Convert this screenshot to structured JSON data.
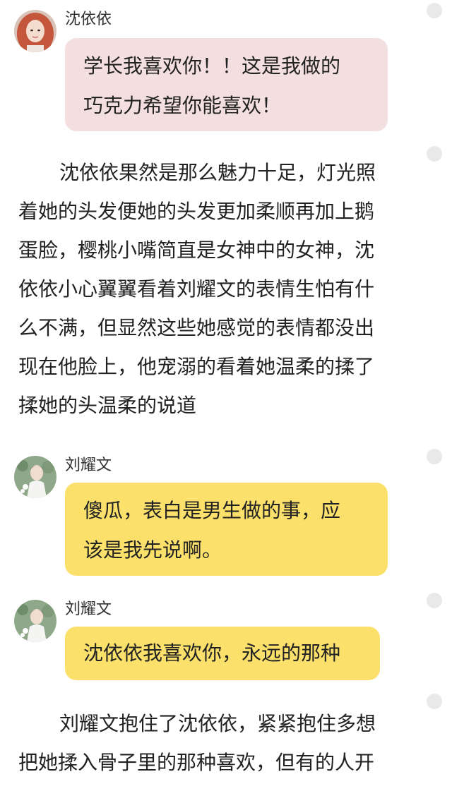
{
  "messages": [
    {
      "speaker": "沈依依",
      "bubble_lines": [
        "学长我喜欢你！！这是我做的",
        "巧克力希望你能喜欢！"
      ],
      "bubble_color": "#f3dfdf",
      "avatar": "female-avatar"
    },
    {
      "speaker": "刘耀文",
      "bubble_lines": [
        "傻瓜，表白是男生做的事，应",
        "该是我先说啊。"
      ],
      "bubble_color": "#fbe16c",
      "avatar": "male-avatar"
    },
    {
      "speaker": "刘耀文",
      "bubble_lines": [
        "沈依依我喜欢你，永远的那种"
      ],
      "bubble_color": "#fbe16c",
      "avatar": "male-avatar"
    }
  ],
  "narrations": [
    {
      "lines": [
        "沈依依果然是那么魅力十足，灯光照",
        "着她的头发便她的头发更加柔顺再加上鹅",
        "蛋脸，樱桃小嘴简直是女神中的女神，沈",
        "依依小心翼翼看着刘耀文的表情生怕有什",
        "么不满，但显然这些她感觉的表情都没出",
        "现在他脸上，他宠溺的看着她温柔的揉了",
        "揉她的头温柔的说道"
      ]
    },
    {
      "lines": [
        "刘耀文抱住了沈依依，紧紧抱住多想",
        "把她揉入骨子里的那种喜欢，但有的人开"
      ]
    }
  ],
  "colors": {
    "pink_bubble": "#f3dfdf",
    "yellow_bubble": "#fbe16c",
    "dot": "#e9e9e9"
  }
}
